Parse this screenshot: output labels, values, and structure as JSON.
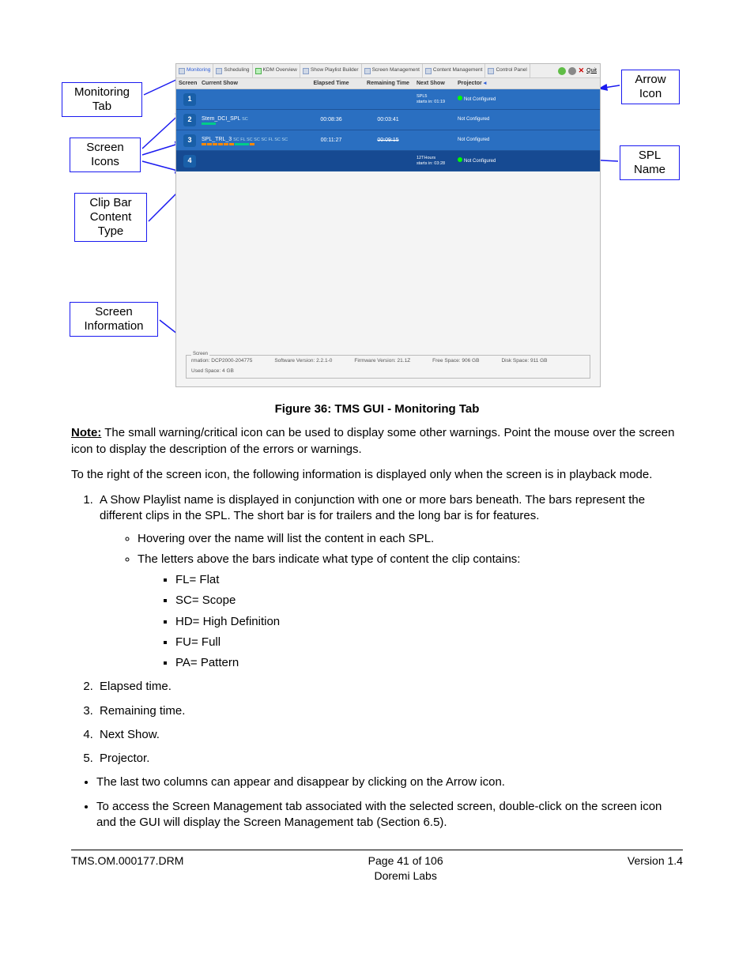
{
  "figure": {
    "caption": "Figure 36: TMS GUI - Monitoring Tab",
    "callouts": {
      "monitoring_tab": "Monitoring\nTab",
      "screen_icons": "Screen\nIcons",
      "clip_bar": "Clip Bar\nContent\nType",
      "screen_info": "Screen\nInformation",
      "arrow_icon": "Arrow\nIcon",
      "spl_name": "SPL\nName"
    },
    "gui": {
      "tabs": [
        "Monitoring",
        "Scheduling",
        "KDM Overview",
        "Show Playlist Builder",
        "Screen Management",
        "Content Management",
        "Control Panel"
      ],
      "quit": "Quit",
      "headers": [
        "Screen",
        "Current Show",
        "Elapsed Time",
        "Remaining Time",
        "Next Show",
        "Projector"
      ],
      "rows": [
        {
          "num": "1",
          "spl": "",
          "elapsed": "",
          "remain": "",
          "next": "SPL5",
          "starts": "starts in: 01:19",
          "proj": "Not Configured",
          "led": true
        },
        {
          "num": "2",
          "spl": "Stem_DCI_SPL",
          "elapsed": "00:08:36",
          "remain": "00:03:41",
          "next": "",
          "starts": "",
          "proj": "Not Configured",
          "led": false
        },
        {
          "num": "3",
          "spl": "SPL_TRL_3",
          "elapsed": "00:11:27",
          "remain": "00:09:15",
          "next": "",
          "starts": "",
          "proj": "Not Configured",
          "led": false
        },
        {
          "num": "4",
          "spl": "",
          "elapsed": "",
          "remain": "",
          "next": "12THours",
          "starts": "starts in: 03:28",
          "proj": "Not Configured",
          "led": true
        }
      ],
      "screen_info": {
        "title": "Screen",
        "items": [
          {
            "k": "rmation:",
            "v": "DCP2000-204775"
          },
          {
            "k": "Software Version:",
            "v": "2.2.1-0"
          },
          {
            "k": "Firmware Version:",
            "v": "21.1Z"
          },
          {
            "k": "Free Space:",
            "v": "906 GB"
          },
          {
            "k": "Disk Space:",
            "v": "911 GB"
          },
          {
            "k": "Used Space:",
            "v": "4 GB"
          }
        ]
      }
    }
  },
  "note": {
    "label": "Note:",
    "text": " The small warning/critical icon can be used to display some other warnings. Point the mouse over the screen icon to display the description of the errors or warnings."
  },
  "intro": "To the right of the screen icon, the following information is displayed only when the screen is in playback mode.",
  "list": {
    "i1": "A Show Playlist name is displayed in conjunction with one or more bars beneath. The bars represent the different clips in the SPL. The short bar is for trailers and the long bar is for features.",
    "i1a": "Hovering over the name will list the content in each SPL.",
    "i1b": "The letters above the bars indicate what type of content the clip contains:",
    "codes": [
      "FL= Flat",
      "SC= Scope",
      "HD= High Definition",
      "FU= Full",
      "PA= Pattern"
    ],
    "i2": "Elapsed time.",
    "i3": "Remaining time.",
    "i4": "Next Show.",
    "i5": "Projector.",
    "b1": "The last two columns can appear and disappear by clicking on the Arrow icon.",
    "b2": "To access the Screen Management tab associated with the selected screen, double-click on the screen icon and the GUI will display the Screen Management tab (Section 6.5)."
  },
  "footer": {
    "left": "TMS.OM.000177.DRM",
    "center_top": "Page 41 of 106",
    "center_bot": "Doremi Labs",
    "right": "Version 1.4"
  }
}
